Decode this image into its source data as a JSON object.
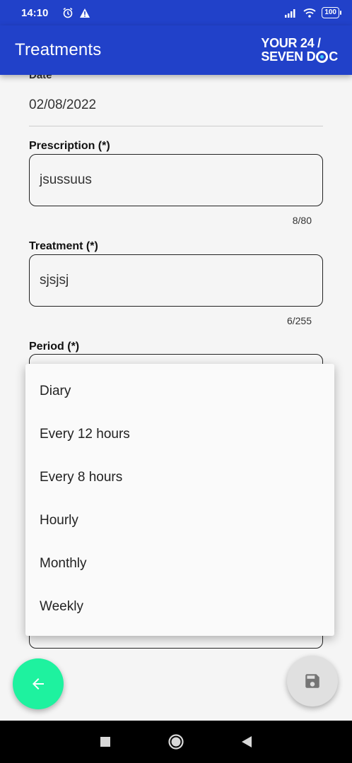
{
  "status_bar": {
    "time": "14:10",
    "battery": "100"
  },
  "app_bar": {
    "title": "Treatments",
    "logo_line1": "YOUR 24 /",
    "logo_line2_a": "SEVEN D",
    "logo_line2_b": "C"
  },
  "form": {
    "date_label": "Date",
    "date_value": "02/08/2022",
    "prescription_label": "Prescription (*)",
    "prescription_value": "jsussuus",
    "prescription_counter": "8/80",
    "treatment_label": "Treatment (*)",
    "treatment_value": "sjsjsj",
    "treatment_counter": "6/255",
    "period_label": "Period (*)"
  },
  "dropdown": {
    "options": [
      "Diary",
      "Every 12 hours",
      "Every 8 hours",
      "Hourly",
      "Monthly",
      "Weekly"
    ]
  },
  "icons": {
    "alarm": "alarm-icon",
    "warning": "warning-icon",
    "signal": "signal-icon",
    "wifi": "wifi-icon",
    "back": "arrow-left-icon",
    "save": "save-icon",
    "nav_recent": "square-icon",
    "nav_home": "circle-icon",
    "nav_back": "triangle-icon"
  },
  "colors": {
    "primary": "#2141c9",
    "fab_back": "#1ef29f",
    "fab_save": "#e0e0e0"
  }
}
